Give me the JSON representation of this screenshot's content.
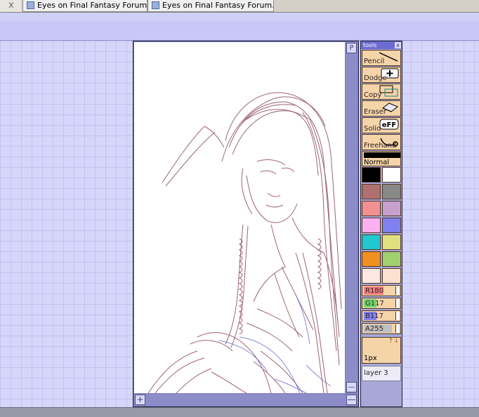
{
  "browser": {
    "close_glyph": "x",
    "tabs": [
      {
        "label": "Eyes on Final Fantasy Forum..."
      },
      {
        "label": "Eyes on Final Fantasy Forum..."
      }
    ]
  },
  "canvas": {
    "scroll_up_glyph": "P",
    "scroll_down_glyph": "—",
    "zoom_in_glyph": "+",
    "zoom_out_glyph": "—"
  },
  "tools": {
    "title": "tools",
    "close_glyph": "x",
    "items": [
      {
        "label": "Pencil",
        "icon": "pencil-line-icon"
      },
      {
        "label": "Dodge",
        "icon": "plus-box-icon"
      },
      {
        "label": "Copy",
        "icon": "copy-rect-icon"
      },
      {
        "label": "Eraser",
        "icon": "eraser-icon"
      },
      {
        "label": "Solid",
        "icon": "eff-icon"
      },
      {
        "label": "Freehand",
        "icon": "lasso-icon"
      }
    ],
    "eff_text": "eFF",
    "blend_mode": "Normal",
    "palette": [
      "#000000",
      "#ffffff",
      "#b07070",
      "#888888",
      "#f09090",
      "#c8a0d0",
      "#fcb0f0",
      "#8080f0",
      "#20c8d0",
      "#e0e080",
      "#f09020",
      "#a0d070",
      "#fce8e0",
      "#fce0d0"
    ],
    "sliders": [
      {
        "label": "R180",
        "value": 180,
        "color": "#f08080"
      },
      {
        "label": "G117",
        "value": 117,
        "color": "#70d870"
      },
      {
        "label": "B117",
        "value": 117,
        "color": "#8080f0"
      },
      {
        "label": "A255",
        "value": 255,
        "color": "#c0c0c0"
      }
    ],
    "brush_size": "1px",
    "brush_arrows": "↑↓",
    "layer": "layer 3"
  },
  "colors": {
    "stroke_main": "#8a4a5e",
    "stroke_blue": "#6a6ad0"
  }
}
